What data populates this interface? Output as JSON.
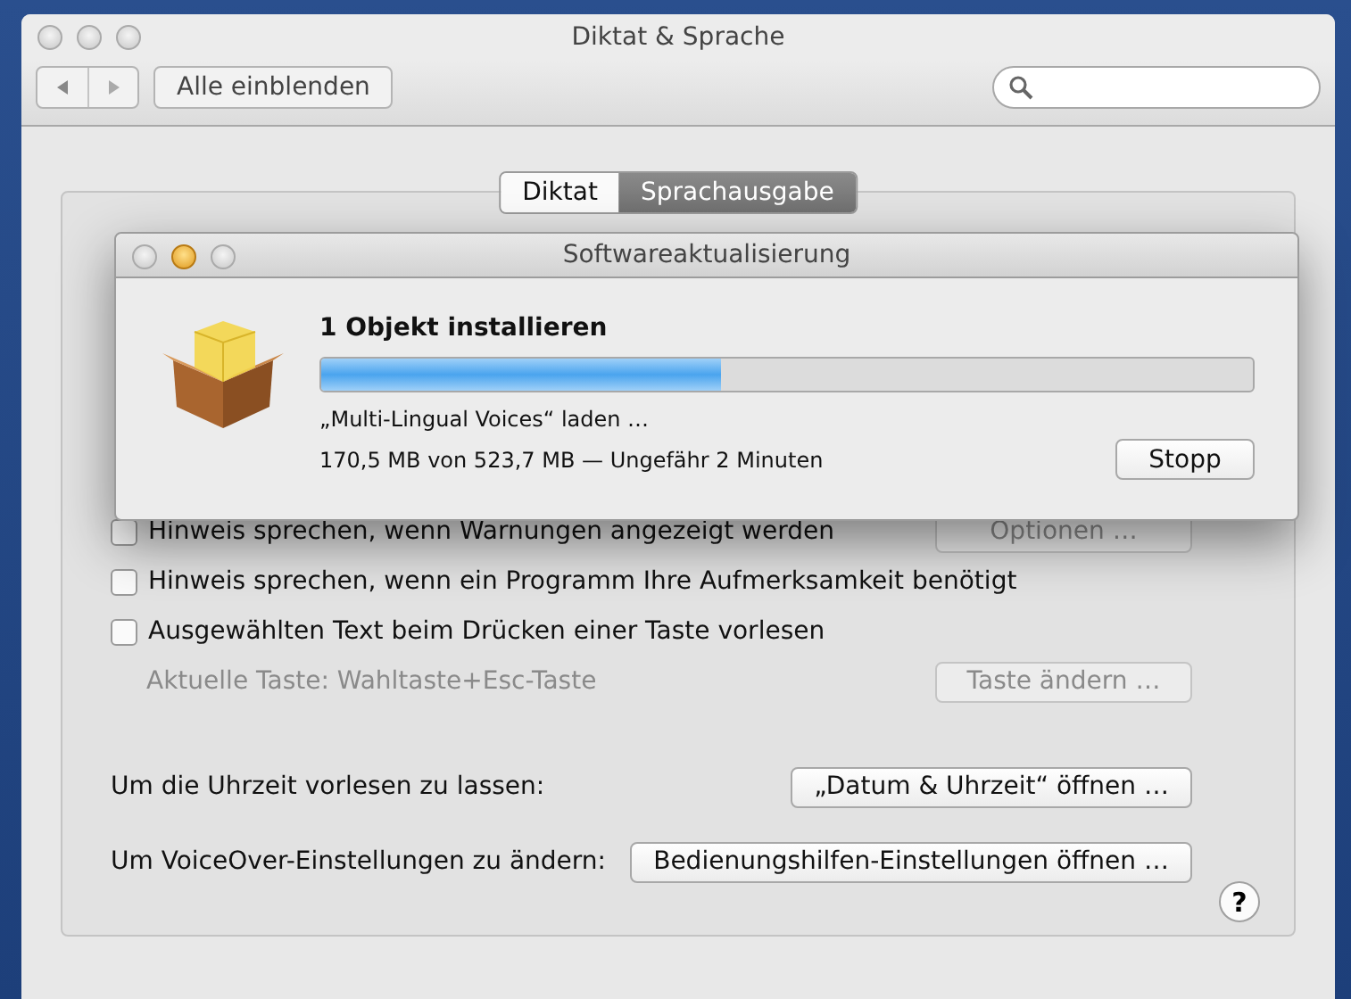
{
  "window": {
    "title": "Diktat & Sprache"
  },
  "toolbar": {
    "show_all_button": "Alle einblenden"
  },
  "tabs": [
    {
      "label": "Diktat",
      "selected": false
    },
    {
      "label": "Sprachausgabe",
      "selected": true
    }
  ],
  "options": [
    {
      "kind": "checkbox",
      "label": "Hinweis sprechen, wenn Warnungen angezeigt werden",
      "checked": false,
      "button": {
        "label": "Optionen …",
        "disabled": true
      }
    },
    {
      "kind": "checkbox",
      "label": "Hinweis sprechen, wenn ein Programm Ihre Aufmerksamkeit benötigt",
      "checked": false
    },
    {
      "kind": "checkbox",
      "label": "Ausgewählten Text beim Drücken einer Taste vorlesen",
      "checked": false
    },
    {
      "kind": "note",
      "label": "Aktuelle Taste: Wahltaste+Esc-Taste",
      "disabled": true,
      "button": {
        "label": "Taste ändern …",
        "disabled": true
      }
    }
  ],
  "links": [
    {
      "label": "Um die Uhrzeit vorlesen zu lassen:",
      "button": "„Datum & Uhrzeit“ öffnen …"
    },
    {
      "label": "Um VoiceOver-Einstellungen zu ändern:",
      "button": "Bedienungshilfen-Einstellungen öffnen …"
    }
  ],
  "help_button": "?",
  "dialog": {
    "title": "Softwareaktualisierung",
    "heading": "1 Objekt installieren",
    "progress": {
      "level": 0.43
    },
    "status": "„Multi-Lingual Voices“ laden …",
    "detail": "170,5 MB von 523,7 MB — Ungefähr 2 Minuten",
    "button": "Stopp"
  }
}
